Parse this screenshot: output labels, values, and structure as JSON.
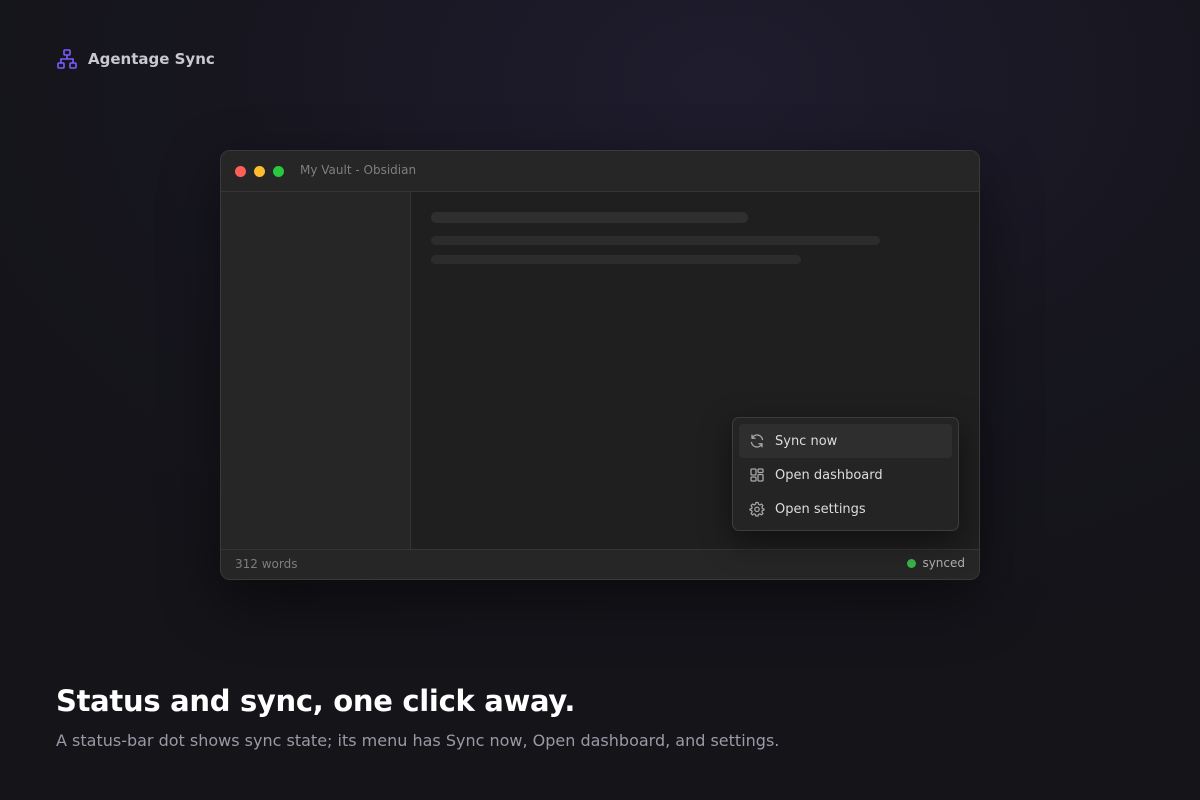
{
  "brand": {
    "name": "Agentage Sync",
    "icon": "sitemap-icon",
    "color": "#7c5cff"
  },
  "window": {
    "title": "My Vault - Obsidian",
    "status_bar": {
      "word_count": "312 words",
      "sync_label": "synced",
      "sync_color": "#3bb54a"
    }
  },
  "menu": {
    "items": [
      {
        "label": "Sync now",
        "icon": "refresh-icon"
      },
      {
        "label": "Open dashboard",
        "icon": "dashboard-icon"
      },
      {
        "label": "Open settings",
        "icon": "gear-icon"
      }
    ]
  },
  "caption": {
    "headline": "Status and sync, one click away.",
    "subline": "A status-bar dot shows sync state; its menu has Sync now, Open dashboard, and settings."
  }
}
